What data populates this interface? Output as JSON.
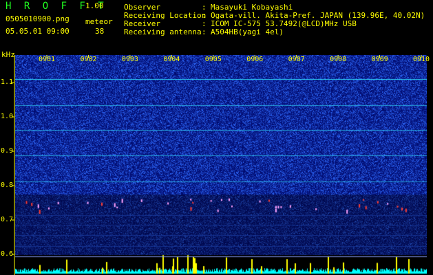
{
  "app": {
    "title": "H R O F F T",
    "version": "1.00",
    "filename": "0505010900.png",
    "mode_label": "meteor",
    "datetime": "05.05.01 09:00",
    "count": "38"
  },
  "header": {
    "rows": [
      {
        "label": "Observer",
        "value": "Masayuki Kobayashi"
      },
      {
        "label": "Receiving Location",
        "value": "Ogata-vill. Akita-Pref. JAPAN (139.96E, 40.02N)"
      },
      {
        "label": "Receiver",
        "value": "ICOM IC-575 53.7492(@LCD)MHz USB"
      },
      {
        "label": "Receiving antenna",
        "value": "A504HB(yagi 4el)"
      }
    ]
  },
  "spectrogram": {
    "y_unit": "kHz",
    "y_ticks": [
      "1.1",
      "1.0",
      "0.9",
      "0.8",
      "0.7",
      "0.6"
    ],
    "y_range_khz": [
      0.6,
      1.18
    ],
    "x_ticks": [
      "0901",
      "0902",
      "0903",
      "0904",
      "0905",
      "0906",
      "0907",
      "0908",
      "0909",
      "0910"
    ],
    "carrier_lines_khz": [
      1.11,
      1.035,
      0.962,
      0.888,
      0.812
    ],
    "colors": {
      "background": "#000000",
      "noise_dark": "#000a6e",
      "noise_light": "#2f6bff",
      "carrier": "#32e6ff",
      "meteor": "#ff3c32",
      "axis_text": "#ffff00",
      "title": "#21ff21",
      "level_trace": "#00ffff",
      "level_peak": "#ffff00"
    }
  }
}
